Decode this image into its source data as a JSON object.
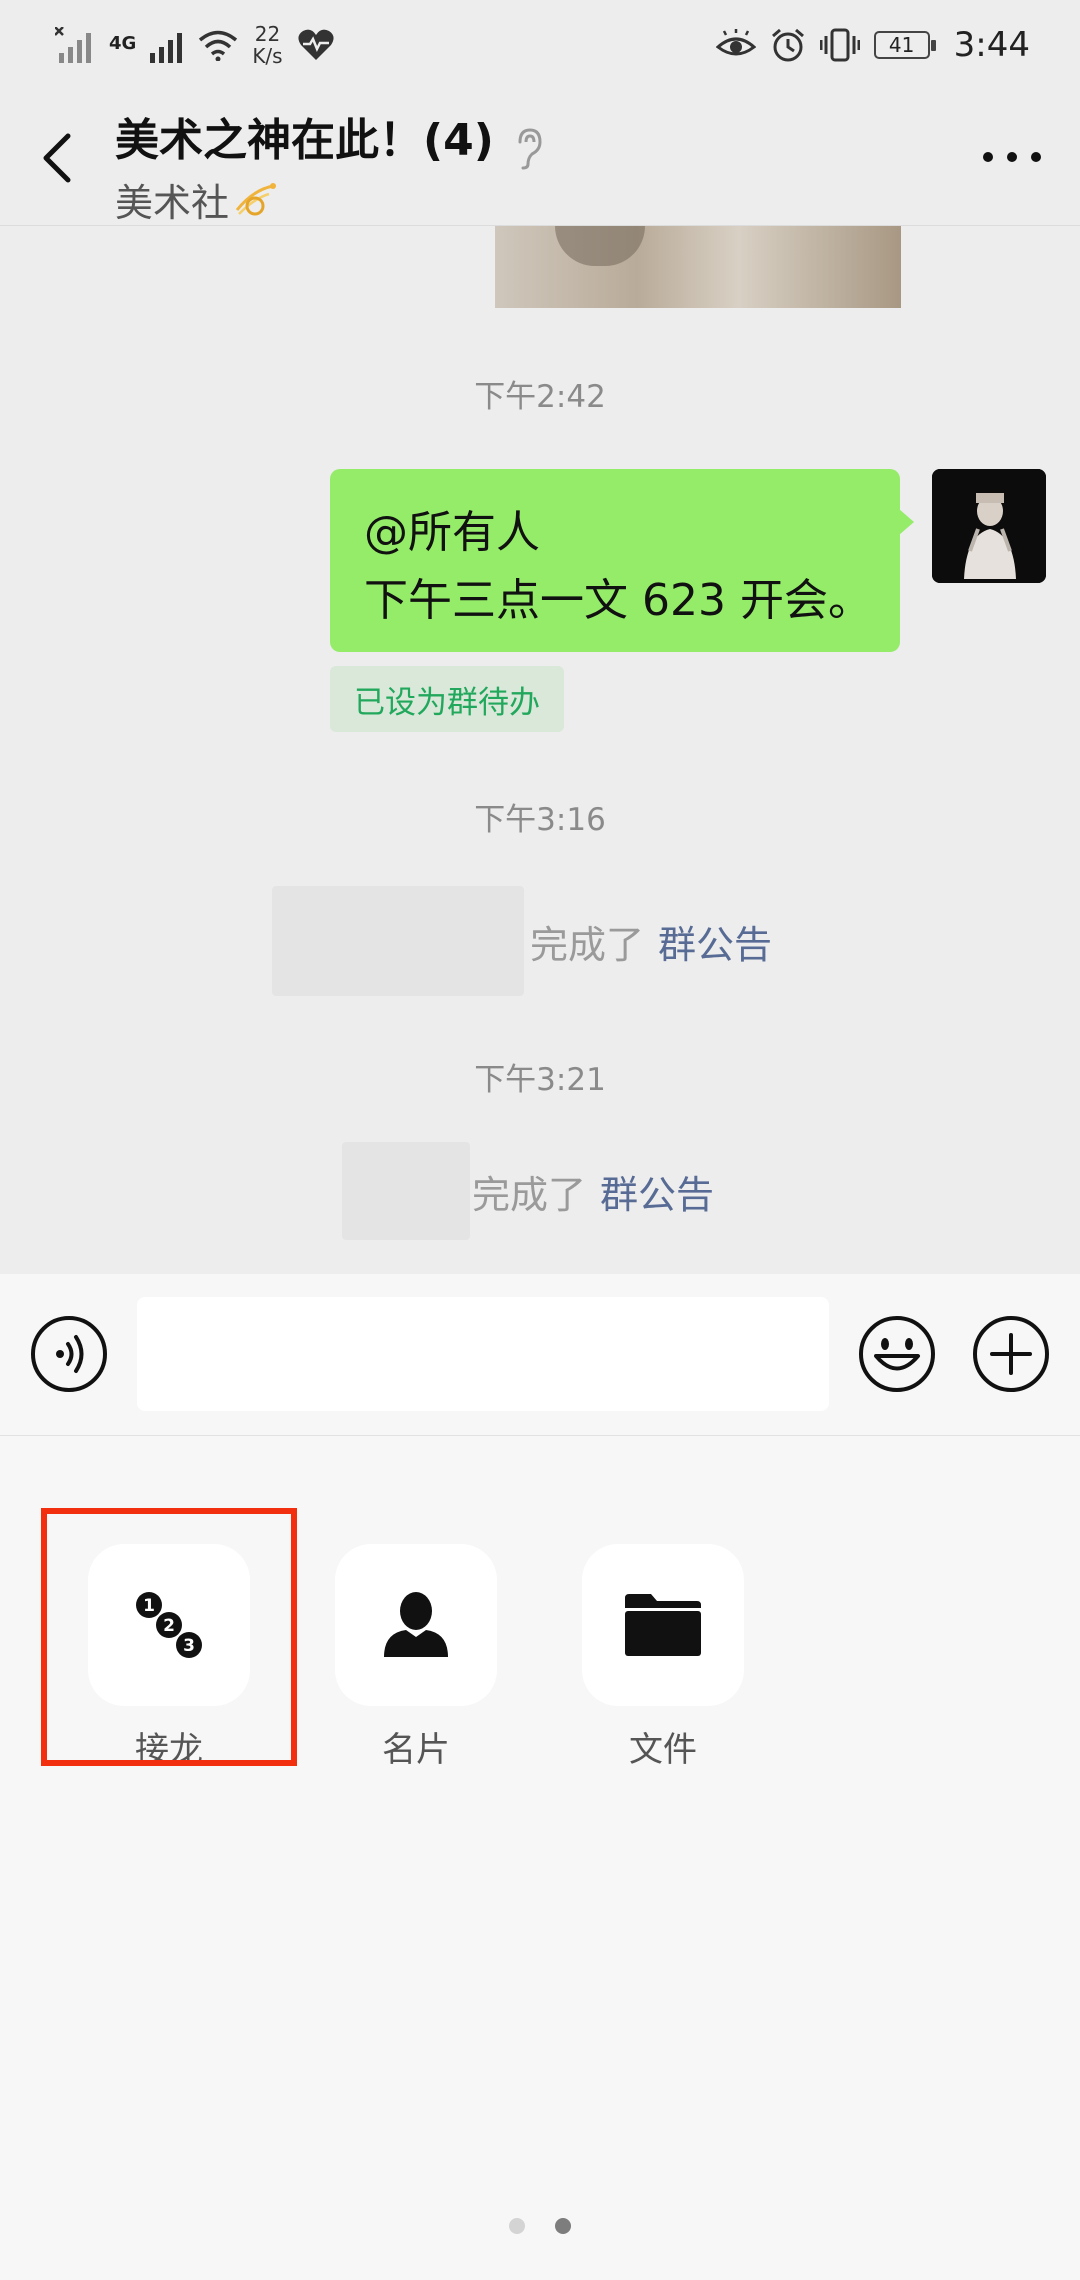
{
  "status_bar": {
    "network_label": "4G",
    "speed_value": "22",
    "speed_unit": "K/s",
    "battery_level": "41",
    "time": "3:44"
  },
  "header": {
    "title": "美术之神在此！(4)",
    "subtitle": "美术社"
  },
  "chat": {
    "messages": [
      {
        "type": "timestamp",
        "text": "下午2:42"
      },
      {
        "type": "outgoing",
        "lines": [
          "@所有人",
          "下午三点一文 623 开会。"
        ],
        "badge": "已设为群待办"
      },
      {
        "type": "timestamp",
        "text": "下午3:16"
      },
      {
        "type": "system",
        "text": "完成了",
        "link": "群公告"
      },
      {
        "type": "timestamp",
        "text": "下午3:21"
      },
      {
        "type": "system",
        "text": "完成了",
        "link": "群公告"
      }
    ]
  },
  "input_bar": {
    "value": "",
    "placeholder": ""
  },
  "panel": {
    "items": [
      {
        "label": "接龙",
        "icon": "numbered-steps-icon"
      },
      {
        "label": "名片",
        "icon": "contact-card-icon"
      },
      {
        "label": "文件",
        "icon": "folder-icon"
      }
    ],
    "highlighted_index": 0,
    "page_count": 2,
    "current_page": 2
  },
  "colors": {
    "bubble": "#95ec69",
    "badge_text": "#22a85d",
    "link": "#576b95",
    "highlight": "#f2300f"
  }
}
